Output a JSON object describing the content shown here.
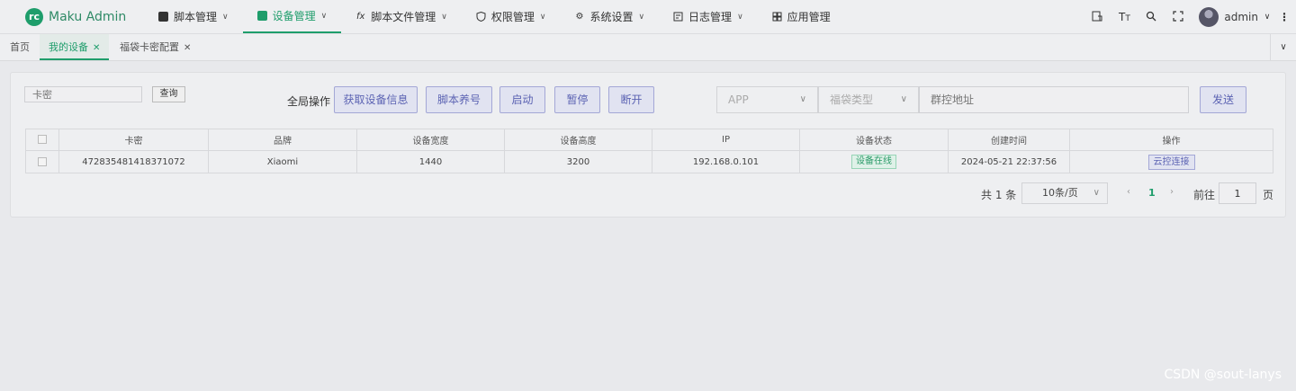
{
  "app": {
    "logo_text": "rc",
    "title": "Maku Admin"
  },
  "menu": [
    {
      "label": "脚本管理",
      "icon": "script-box-icon",
      "has_dropdown": true,
      "active": false
    },
    {
      "label": "设备管理",
      "icon": "device-box-icon",
      "has_dropdown": true,
      "active": true
    },
    {
      "label": "脚本文件管理",
      "icon": "fx-icon",
      "has_dropdown": true,
      "active": false
    },
    {
      "label": "权限管理",
      "icon": "shield-icon",
      "has_dropdown": true,
      "active": false
    },
    {
      "label": "系统设置",
      "icon": "gear-icon",
      "has_dropdown": true,
      "active": false
    },
    {
      "label": "日志管理",
      "icon": "log-icon",
      "has_dropdown": true,
      "active": false
    },
    {
      "label": "应用管理",
      "icon": "grid-icon",
      "has_dropdown": false,
      "active": false
    }
  ],
  "header_tools": [
    "translate-icon",
    "font-size-icon",
    "search-icon",
    "fullscreen-icon"
  ],
  "user": {
    "name": "admin"
  },
  "tabs": [
    {
      "label": "首页",
      "closable": false,
      "active": false
    },
    {
      "label": "我的设备",
      "closable": true,
      "active": true
    },
    {
      "label": "福袋卡密配置",
      "closable": true,
      "active": false
    }
  ],
  "filter": {
    "card_placeholder": "卡密",
    "query_label": "查询"
  },
  "global_ops": {
    "label": "全局操作",
    "buttons": [
      "获取设备信息",
      "脚本养号",
      "启动",
      "暂停",
      "断开"
    ]
  },
  "send_form": {
    "app_placeholder": "APP",
    "type_placeholder": "福袋类型",
    "address_placeholder": "群控地址",
    "send_label": "发送"
  },
  "table": {
    "columns": [
      "卡密",
      "品牌",
      "设备宽度",
      "设备高度",
      "IP",
      "设备状态",
      "创建时间",
      "操作"
    ],
    "rows": [
      {
        "card": "472835481418371072",
        "brand": "Xiaomi",
        "width": "1440",
        "height": "3200",
        "ip": "192.168.0.101",
        "status": "设备在线",
        "created": "2024-05-21 22:37:56",
        "action": "云控连接"
      }
    ]
  },
  "pagination": {
    "total_text": "共 1 条",
    "page_size": "10条/页",
    "current_page": "1",
    "goto_label": "前往",
    "goto_value": "1",
    "page_suffix": "页"
  },
  "watermark": "CSDN @sout-lanys",
  "colors": {
    "accent": "#1e9d6b",
    "button": "#5c63b3",
    "online": "#2a9a68"
  }
}
